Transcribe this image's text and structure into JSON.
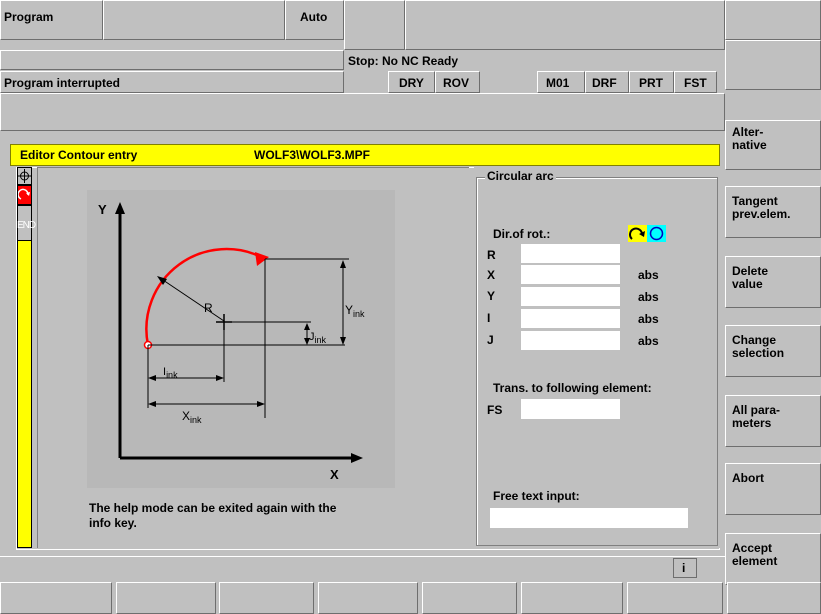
{
  "header": {
    "program_label": "Program",
    "mode": "Auto",
    "stop_message": "Stop: No NC Ready",
    "program_status": "Program interrupted",
    "indicators": [
      "DRY",
      "ROV",
      "M01",
      "DRF",
      "PRT",
      "FST"
    ]
  },
  "editor": {
    "title": "Editor  Contour entry",
    "file": "WOLF3\\WOLF3.MPF",
    "side_end_label": "END"
  },
  "diagram": {
    "axis_x": "X",
    "axis_y": "Y",
    "radius": "R",
    "ink_y": "Y",
    "ink_x": "X",
    "ink_i": "I",
    "ink_j": "J",
    "ink_sub": "ink"
  },
  "help_text": {
    "line1": "The help mode can be exited again with the",
    "line2": "info key."
  },
  "form": {
    "group_title": "Circular arc",
    "dir_rot_label": "Dir.of rot.:",
    "params": [
      {
        "label": "R",
        "value": "",
        "unit": ""
      },
      {
        "label": "X",
        "value": "",
        "unit": "abs"
      },
      {
        "label": "Y",
        "value": "",
        "unit": "abs"
      },
      {
        "label": "I",
        "value": "",
        "unit": "abs"
      },
      {
        "label": "J",
        "value": "",
        "unit": "abs"
      }
    ],
    "trans_label": "Trans. to following element:",
    "fs_label": "FS",
    "fs_value": "",
    "free_text_label": "Free text input:",
    "free_text_value": ""
  },
  "softkeys_vertical": [
    "",
    "",
    "Alter-\nnative",
    "Tangent\nprev.elem.",
    "Delete\nvalue",
    "Change\nselection",
    "All para-\nmeters",
    "Abort",
    "Accept\nelement"
  ],
  "info_key": "i",
  "colors": {
    "background": "#c0c0c0",
    "title_bar": "#ffff00",
    "accent_red": "#ff0000",
    "cyan": "#00ffff"
  }
}
